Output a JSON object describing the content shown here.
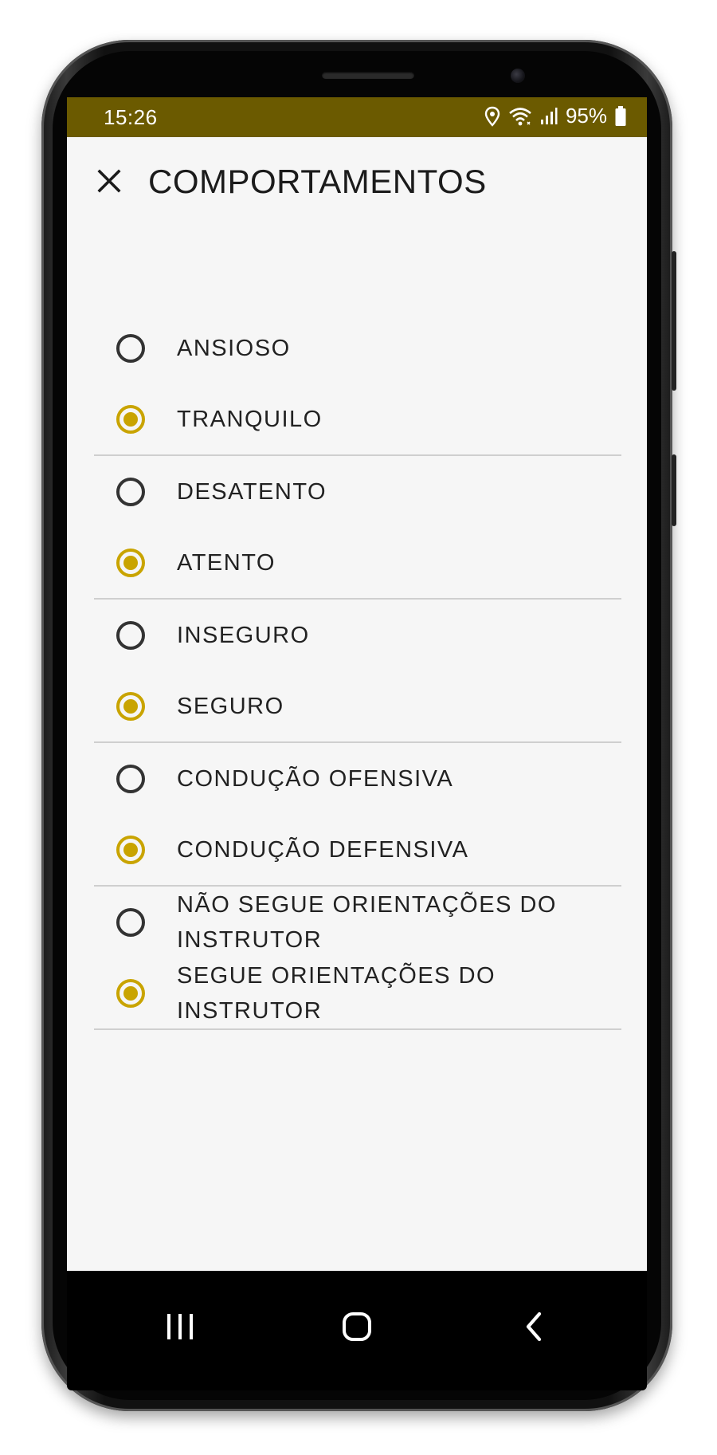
{
  "status_bar": {
    "time": "15:26",
    "battery": "95%",
    "icons": [
      "location-icon",
      "wifi-icon",
      "signal-icon",
      "battery-icon"
    ],
    "background": "#6b5a00"
  },
  "app_bar": {
    "close_icon": "close-icon",
    "title": "COMPORTAMENTOS"
  },
  "colors": {
    "accent": "#c9a400",
    "divider": "#cfcfcf",
    "screen_bg": "#f6f6f6"
  },
  "groups": [
    {
      "options": [
        {
          "label": "ANSIOSO",
          "checked": false
        },
        {
          "label": "TRANQUILO",
          "checked": true
        }
      ]
    },
    {
      "options": [
        {
          "label": "DESATENTO",
          "checked": false
        },
        {
          "label": "ATENTO",
          "checked": true
        }
      ]
    },
    {
      "options": [
        {
          "label": "INSEGURO",
          "checked": false
        },
        {
          "label": "SEGURO",
          "checked": true
        }
      ]
    },
    {
      "options": [
        {
          "label": "CONDUÇÃO OFENSIVA",
          "checked": false
        },
        {
          "label": "CONDUÇÃO DEFENSIVA",
          "checked": true
        }
      ]
    },
    {
      "options": [
        {
          "label": "NÃO SEGUE ORIENTAÇÕES DO INSTRUTOR",
          "checked": false
        },
        {
          "label": "SEGUE ORIENTAÇÕES DO INSTRUTOR",
          "checked": true
        }
      ]
    }
  ],
  "nav_bar": {
    "buttons": [
      "recent-apps-icon",
      "home-icon",
      "back-icon"
    ]
  }
}
